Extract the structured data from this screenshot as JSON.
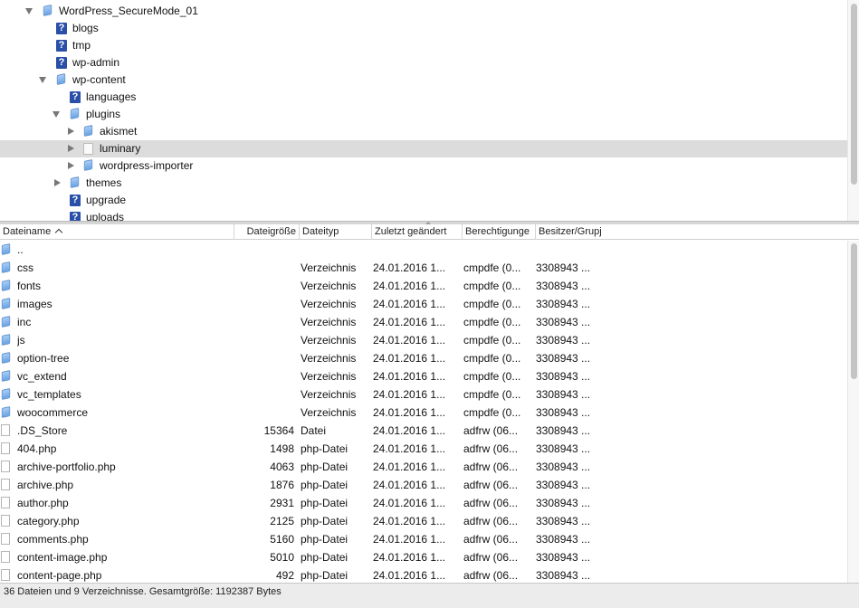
{
  "tree": {
    "items": [
      {
        "label": "WordPress_SecureMode_01",
        "icon": "folder-icon",
        "toggle": "expanded",
        "depth": 0
      },
      {
        "label": "blogs",
        "icon": "unknown-folder-icon",
        "toggle": "none",
        "depth": 1
      },
      {
        "label": "tmp",
        "icon": "unknown-folder-icon",
        "toggle": "none",
        "depth": 1
      },
      {
        "label": "wp-admin",
        "icon": "unknown-folder-icon",
        "toggle": "none",
        "depth": 1
      },
      {
        "label": "wp-content",
        "icon": "folder-icon",
        "toggle": "expanded",
        "depth": 1
      },
      {
        "label": "languages",
        "icon": "unknown-folder-icon",
        "toggle": "none",
        "depth": 2
      },
      {
        "label": "plugins",
        "icon": "folder-icon",
        "toggle": "expanded",
        "depth": 2
      },
      {
        "label": "akismet",
        "icon": "folder-icon",
        "toggle": "collapsed",
        "depth": 3
      },
      {
        "label": "luminary",
        "icon": "open-folder-icon",
        "toggle": "collapsed",
        "depth": 3,
        "selected": true
      },
      {
        "label": "wordpress-importer",
        "icon": "folder-icon",
        "toggle": "collapsed",
        "depth": 3
      },
      {
        "label": "themes",
        "icon": "folder-icon",
        "toggle": "collapsed",
        "depth": 2
      },
      {
        "label": "upgrade",
        "icon": "unknown-folder-icon",
        "toggle": "none",
        "depth": 2
      },
      {
        "label": "uploads",
        "icon": "unknown-folder-icon",
        "toggle": "none",
        "depth": 2
      }
    ]
  },
  "file_list": {
    "columns": {
      "name": "Dateiname",
      "size": "Dateigröße",
      "type": "Dateityp",
      "modified": "Zuletzt geändert",
      "permissions": "Berechtigunge",
      "owner": "Besitzer/Grupj"
    },
    "sort_icon": "chevron-up-icon",
    "rows": [
      {
        "name": "..",
        "size": "",
        "type": "",
        "modified": "",
        "permissions": "",
        "owner": "",
        "icon": "folder-icon"
      },
      {
        "name": "css",
        "size": "",
        "type": "Verzeichnis",
        "modified": "24.01.2016 1...",
        "permissions": "cmpdfe (0...",
        "owner": "3308943 ...",
        "icon": "folder-icon"
      },
      {
        "name": "fonts",
        "size": "",
        "type": "Verzeichnis",
        "modified": "24.01.2016 1...",
        "permissions": "cmpdfe (0...",
        "owner": "3308943 ...",
        "icon": "folder-icon"
      },
      {
        "name": "images",
        "size": "",
        "type": "Verzeichnis",
        "modified": "24.01.2016 1...",
        "permissions": "cmpdfe (0...",
        "owner": "3308943 ...",
        "icon": "folder-icon"
      },
      {
        "name": "inc",
        "size": "",
        "type": "Verzeichnis",
        "modified": "24.01.2016 1...",
        "permissions": "cmpdfe (0...",
        "owner": "3308943 ...",
        "icon": "folder-icon"
      },
      {
        "name": "js",
        "size": "",
        "type": "Verzeichnis",
        "modified": "24.01.2016 1...",
        "permissions": "cmpdfe (0...",
        "owner": "3308943 ...",
        "icon": "folder-icon"
      },
      {
        "name": "option-tree",
        "size": "",
        "type": "Verzeichnis",
        "modified": "24.01.2016 1...",
        "permissions": "cmpdfe (0...",
        "owner": "3308943 ...",
        "icon": "folder-icon"
      },
      {
        "name": "vc_extend",
        "size": "",
        "type": "Verzeichnis",
        "modified": "24.01.2016 1...",
        "permissions": "cmpdfe (0...",
        "owner": "3308943 ...",
        "icon": "folder-icon"
      },
      {
        "name": "vc_templates",
        "size": "",
        "type": "Verzeichnis",
        "modified": "24.01.2016 1...",
        "permissions": "cmpdfe (0...",
        "owner": "3308943 ...",
        "icon": "folder-icon"
      },
      {
        "name": "woocommerce",
        "size": "",
        "type": "Verzeichnis",
        "modified": "24.01.2016 1...",
        "permissions": "cmpdfe (0...",
        "owner": "3308943 ...",
        "icon": "folder-icon"
      },
      {
        "name": ".DS_Store",
        "size": "15364",
        "type": "Datei",
        "modified": "24.01.2016 1...",
        "permissions": "adfrw (06...",
        "owner": "3308943 ...",
        "icon": "file-icon"
      },
      {
        "name": "404.php",
        "size": "1498",
        "type": "php-Datei",
        "modified": "24.01.2016 1...",
        "permissions": "adfrw (06...",
        "owner": "3308943 ...",
        "icon": "file-icon"
      },
      {
        "name": "archive-portfolio.php",
        "size": "4063",
        "type": "php-Datei",
        "modified": "24.01.2016 1...",
        "permissions": "adfrw (06...",
        "owner": "3308943 ...",
        "icon": "file-icon"
      },
      {
        "name": "archive.php",
        "size": "1876",
        "type": "php-Datei",
        "modified": "24.01.2016 1...",
        "permissions": "adfrw (06...",
        "owner": "3308943 ...",
        "icon": "file-icon"
      },
      {
        "name": "author.php",
        "size": "2931",
        "type": "php-Datei",
        "modified": "24.01.2016 1...",
        "permissions": "adfrw (06...",
        "owner": "3308943 ...",
        "icon": "file-icon"
      },
      {
        "name": "category.php",
        "size": "2125",
        "type": "php-Datei",
        "modified": "24.01.2016 1...",
        "permissions": "adfrw (06...",
        "owner": "3308943 ...",
        "icon": "file-icon"
      },
      {
        "name": "comments.php",
        "size": "5160",
        "type": "php-Datei",
        "modified": "24.01.2016 1...",
        "permissions": "adfrw (06...",
        "owner": "3308943 ...",
        "icon": "file-icon"
      },
      {
        "name": "content-image.php",
        "size": "5010",
        "type": "php-Datei",
        "modified": "24.01.2016 1...",
        "permissions": "adfrw (06...",
        "owner": "3308943 ...",
        "icon": "file-icon"
      },
      {
        "name": "content-page.php",
        "size": "492",
        "type": "php-Datei",
        "modified": "24.01.2016 1...",
        "permissions": "adfrw (06...",
        "owner": "3308943 ...",
        "icon": "file-icon"
      }
    ]
  },
  "status_bar": {
    "text": "36 Dateien und 9 Verzeichnisse. Gesamtgröße: 1192387 Bytes"
  }
}
